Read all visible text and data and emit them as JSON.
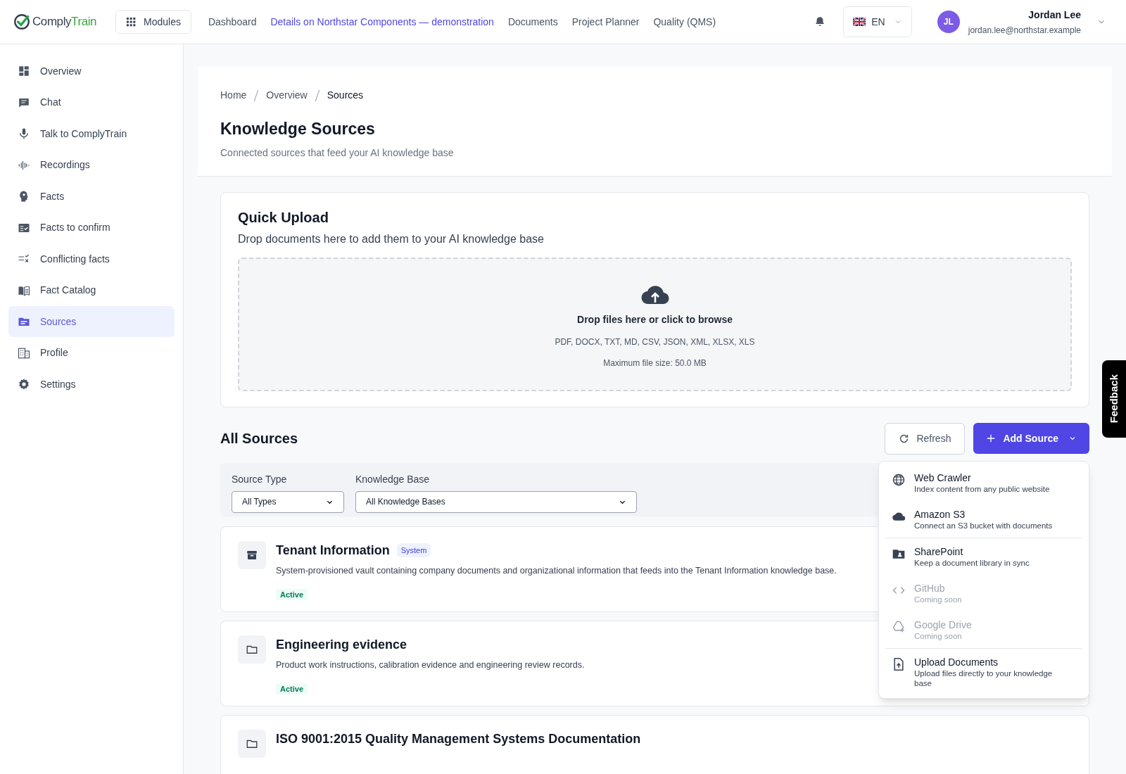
{
  "header": {
    "logo": {
      "first": "Comply",
      "second": "Train"
    },
    "modules_button": "Modules",
    "nav": [
      {
        "label": "Dashboard",
        "selected": false
      },
      {
        "label": "Details on Northstar Components — demonstration",
        "selected": true
      },
      {
        "label": "Documents",
        "selected": false
      },
      {
        "label": "Project Planner",
        "selected": false
      },
      {
        "label": "Quality (QMS)",
        "selected": false
      }
    ],
    "language": "EN",
    "user": {
      "initials": "JL",
      "name": "Jordan Lee",
      "email": "jordan.lee@northstar.example"
    }
  },
  "sidebar": {
    "items": [
      {
        "label": "Overview",
        "selected": false
      },
      {
        "label": "Chat",
        "selected": false
      },
      {
        "label": "Talk to ComplyTrain",
        "selected": false
      },
      {
        "label": "Recordings",
        "selected": false
      },
      {
        "label": "Facts",
        "selected": false
      },
      {
        "label": "Facts to confirm",
        "selected": false
      },
      {
        "label": "Conflicting facts",
        "selected": false
      },
      {
        "label": "Fact Catalog",
        "selected": false
      },
      {
        "label": "Sources",
        "selected": true
      },
      {
        "label": "Profile",
        "selected": false
      },
      {
        "label": "Settings",
        "selected": false
      }
    ]
  },
  "breadcrumb": [
    "Home",
    "Overview",
    "Sources"
  ],
  "title": "Knowledge Sources",
  "subtitle": "Connected sources that feed your AI knowledge base",
  "quick_upload": {
    "title": "Quick Upload",
    "subtitle": "Drop documents here to add them to your AI knowledge base",
    "prompt": "Drop files here or click to browse",
    "formats": "PDF, DOCX, TXT, MD, CSV, JSON, XML, XLSX, XLS",
    "max_size": "Maximum file size: 50.0 MB"
  },
  "all_sources": {
    "title": "All Sources",
    "refresh": "Refresh",
    "add_source": "Add Source",
    "filters": [
      {
        "label": "Source Type",
        "value": "All Types"
      },
      {
        "label": "Knowledge Base",
        "value": "All Knowledge Bases"
      }
    ],
    "sources": [
      {
        "name": "Tenant Information",
        "badge": "System",
        "description": "System-provisioned vault containing company documents and organizational information that feeds into the Tenant Information knowledge base.",
        "status": "Active"
      },
      {
        "name": "Engineering evidence",
        "description": "Product work instructions, calibration evidence and engineering review records.",
        "status": "Active"
      },
      {
        "name": "ISO 9001:2015 Quality Management Systems Documentation"
      }
    ],
    "menu": [
      [
        {
          "title": "Web Crawler",
          "subtitle": "Index content from any public website",
          "disabled": false
        },
        {
          "title": "Amazon S3",
          "subtitle": "Connect an S3 bucket with documents",
          "disabled": false
        }
      ],
      [
        {
          "title": "SharePoint",
          "subtitle": "Keep a document library in sync",
          "disabled": false
        },
        {
          "title": "GitHub",
          "subtitle": "Coming soon",
          "disabled": true
        },
        {
          "title": "Google Drive",
          "subtitle": "Coming soon",
          "disabled": true
        }
      ],
      [
        {
          "title": "Upload Documents",
          "subtitle": "Upload files directly to your knowledge base",
          "disabled": false
        }
      ]
    ]
  },
  "feedback": "Feedback"
}
